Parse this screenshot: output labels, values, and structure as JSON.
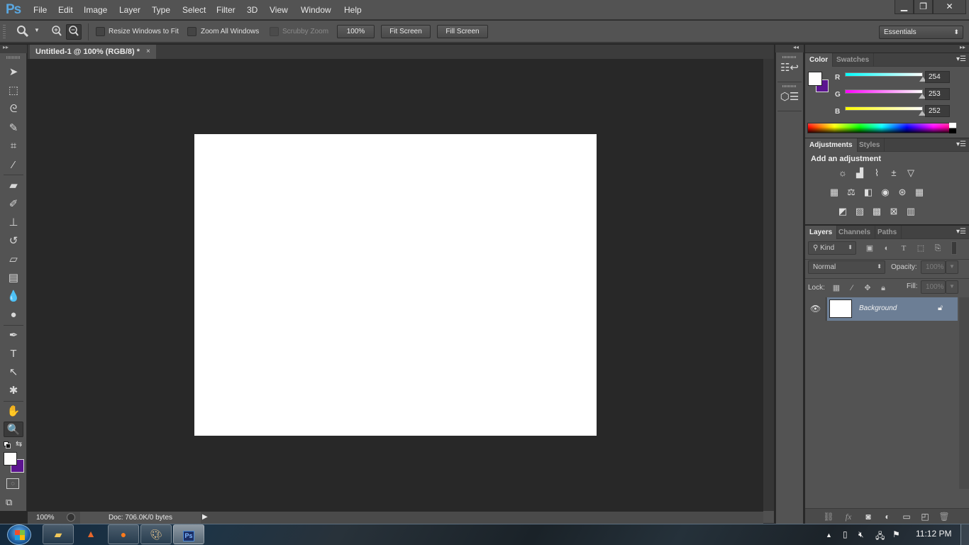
{
  "app": {
    "logo": "Ps",
    "menu": [
      "File",
      "Edit",
      "Image",
      "Layer",
      "Type",
      "Select",
      "Filter",
      "3D",
      "View",
      "Window",
      "Help"
    ],
    "window_controls": {
      "minimize": "▁",
      "restore": "❐",
      "close": "✕"
    }
  },
  "options_bar": {
    "tool_icon": "zoom-icon",
    "zoom_in_icon": "zoom-in-icon",
    "zoom_out_icon": "zoom-out-icon",
    "resize_windows_label": "Resize Windows to Fit",
    "resize_windows_checked": false,
    "zoom_all_label": "Zoom All Windows",
    "zoom_all_checked": false,
    "scrubby_label": "Scrubby Zoom",
    "scrubby_checked": false,
    "btn_100": "100%",
    "btn_fit": "Fit Screen",
    "btn_fill": "Fill Screen",
    "workspace": "Essentials"
  },
  "tools": [
    {
      "name": "move-tool",
      "glyph": "➤"
    },
    {
      "name": "marquee-tool",
      "glyph": "⬚"
    },
    {
      "name": "lasso-tool",
      "glyph": "ᘓ"
    },
    {
      "name": "quick-selection-tool",
      "glyph": "✎"
    },
    {
      "name": "crop-tool",
      "glyph": "⌗"
    },
    {
      "name": "eyedropper-tool",
      "glyph": "⁄"
    },
    {
      "name": "healing-brush-tool",
      "glyph": "▰"
    },
    {
      "name": "brush-tool",
      "glyph": "✐"
    },
    {
      "name": "clone-stamp-tool",
      "glyph": "⊥"
    },
    {
      "name": "history-brush-tool",
      "glyph": "↺"
    },
    {
      "name": "eraser-tool",
      "glyph": "▱"
    },
    {
      "name": "gradient-tool",
      "glyph": "▤"
    },
    {
      "name": "blur-tool",
      "glyph": "💧"
    },
    {
      "name": "dodge-tool",
      "glyph": "●"
    },
    {
      "name": "pen-tool",
      "glyph": "✒"
    },
    {
      "name": "type-tool",
      "glyph": "T"
    },
    {
      "name": "path-selection-tool",
      "glyph": "↖"
    },
    {
      "name": "custom-shape-tool",
      "glyph": "✱"
    },
    {
      "name": "hand-tool",
      "glyph": "✋"
    },
    {
      "name": "zoom-tool",
      "glyph": "🔍",
      "active": true
    }
  ],
  "colors": {
    "foreground": "#fefdfc",
    "background": "#5c1490",
    "layer_selected": "#6c7e95",
    "accent_logo": "#5aa7e0"
  },
  "document": {
    "tab_title": "Untitled-1 @ 100% (RGB/8) *",
    "close": "×",
    "zoom": "100%",
    "doc_info": "Doc: 706.0K/0 bytes",
    "status_arrow": "▶"
  },
  "panels": {
    "collapse": "◂◂",
    "expand": "▸▸",
    "menu_glyph": "▾☰",
    "color": {
      "tabs": [
        "Color",
        "Swatches"
      ],
      "channels": [
        {
          "label": "R",
          "value": "254",
          "fraction": 0.996
        },
        {
          "label": "G",
          "value": "253",
          "fraction": 0.992
        },
        {
          "label": "B",
          "value": "252",
          "fraction": 0.988
        }
      ]
    },
    "adjustments": {
      "tabs": [
        "Adjustments",
        "Styles"
      ],
      "title": "Add an adjustment",
      "rows": [
        [
          {
            "name": "brightness-contrast-icon",
            "g": "☼"
          },
          {
            "name": "levels-icon",
            "g": "▟"
          },
          {
            "name": "curves-icon",
            "g": "⌇"
          },
          {
            "name": "exposure-icon",
            "g": "±"
          },
          {
            "name": "vibrance-icon",
            "g": "▽"
          }
        ],
        [
          {
            "name": "hue-saturation-icon",
            "g": "▦"
          },
          {
            "name": "color-balance-icon",
            "g": "⚖"
          },
          {
            "name": "black-white-icon",
            "g": "◧"
          },
          {
            "name": "photo-filter-icon",
            "g": "◉"
          },
          {
            "name": "channel-mixer-icon",
            "g": "⊛"
          },
          {
            "name": "color-lookup-icon",
            "g": "▦"
          }
        ],
        [
          {
            "name": "invert-icon",
            "g": "◩"
          },
          {
            "name": "posterize-icon",
            "g": "▨"
          },
          {
            "name": "threshold-icon",
            "g": "▩"
          },
          {
            "name": "selective-color-icon",
            "g": "⊠"
          },
          {
            "name": "gradient-map-icon",
            "g": "▥"
          }
        ]
      ]
    },
    "layers": {
      "tabs": [
        "Layers",
        "Channels",
        "Paths"
      ],
      "filter_kind": "Kind",
      "blend_mode": "Normal",
      "opacity_label": "Opacity:",
      "opacity": "100%",
      "lock_label": "Lock:",
      "fill_label": "Fill:",
      "fill": "100%",
      "layer_list": [
        {
          "name": "Background",
          "visible": true,
          "locked": true,
          "selected": true
        }
      ]
    }
  },
  "taskbar": {
    "apps": [
      "file-explorer",
      "matlab",
      "firefox",
      "paint",
      "photoshop"
    ],
    "photoshop_label": "Ps",
    "clock": "11:12 PM"
  }
}
